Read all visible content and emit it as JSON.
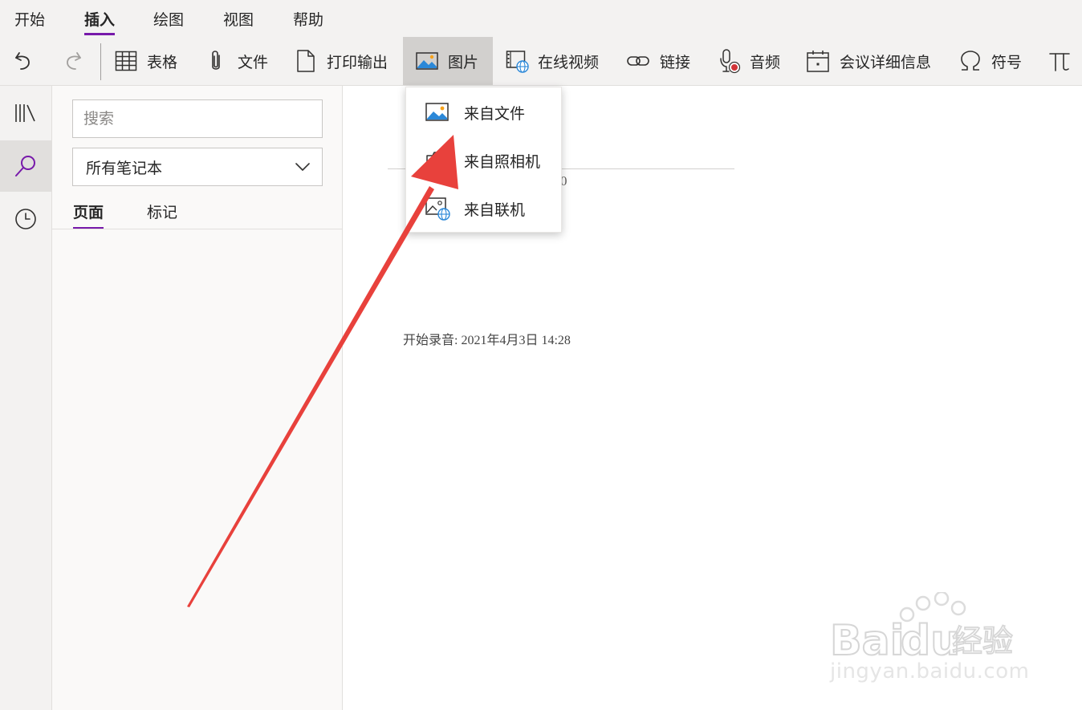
{
  "menubar": {
    "tabs": [
      "开始",
      "插入",
      "绘图",
      "视图",
      "帮助"
    ],
    "active_tab": "插入"
  },
  "ribbon": {
    "undo_icon": "undo-icon",
    "redo_icon": "redo-icon",
    "buttons": [
      {
        "label": "表格",
        "icon": "table-icon"
      },
      {
        "label": "文件",
        "icon": "paperclip-icon"
      },
      {
        "label": "打印输出",
        "icon": "document-icon"
      },
      {
        "label": "图片",
        "icon": "picture-icon"
      },
      {
        "label": "在线视频",
        "icon": "online-video-icon"
      },
      {
        "label": "链接",
        "icon": "link-icon"
      },
      {
        "label": "音频",
        "icon": "audio-record-icon"
      },
      {
        "label": "会议详细信息",
        "icon": "calendar-icon"
      },
      {
        "label": "符号",
        "icon": "omega-icon"
      }
    ],
    "equation_icon": "pi-icon",
    "pressed_button": "图片"
  },
  "picture_menu": {
    "items": [
      {
        "label": "来自文件",
        "icon": "picture-file-icon"
      },
      {
        "label": "来自照相机",
        "icon": "camera-icon"
      },
      {
        "label": "来自联机",
        "icon": "picture-online-icon"
      }
    ]
  },
  "rail": {
    "items": [
      "notebooks-icon",
      "search-icon",
      "recent-icon"
    ],
    "active": "search-icon"
  },
  "search_panel": {
    "placeholder": "搜索",
    "scope": "所有笔记本",
    "tabs": [
      "页面",
      "标记"
    ],
    "active_tab": "页面"
  },
  "page": {
    "date_tail": "0",
    "recording_note": "开始录音: 2021年4月3日 14:28"
  },
  "watermark": {
    "brand": "Baidu经验",
    "url": "jingyan.baidu.com"
  },
  "colors": {
    "accent": "#7719aa",
    "annotation_arrow": "#e8413c",
    "chrome_bg": "#f3f2f1"
  }
}
